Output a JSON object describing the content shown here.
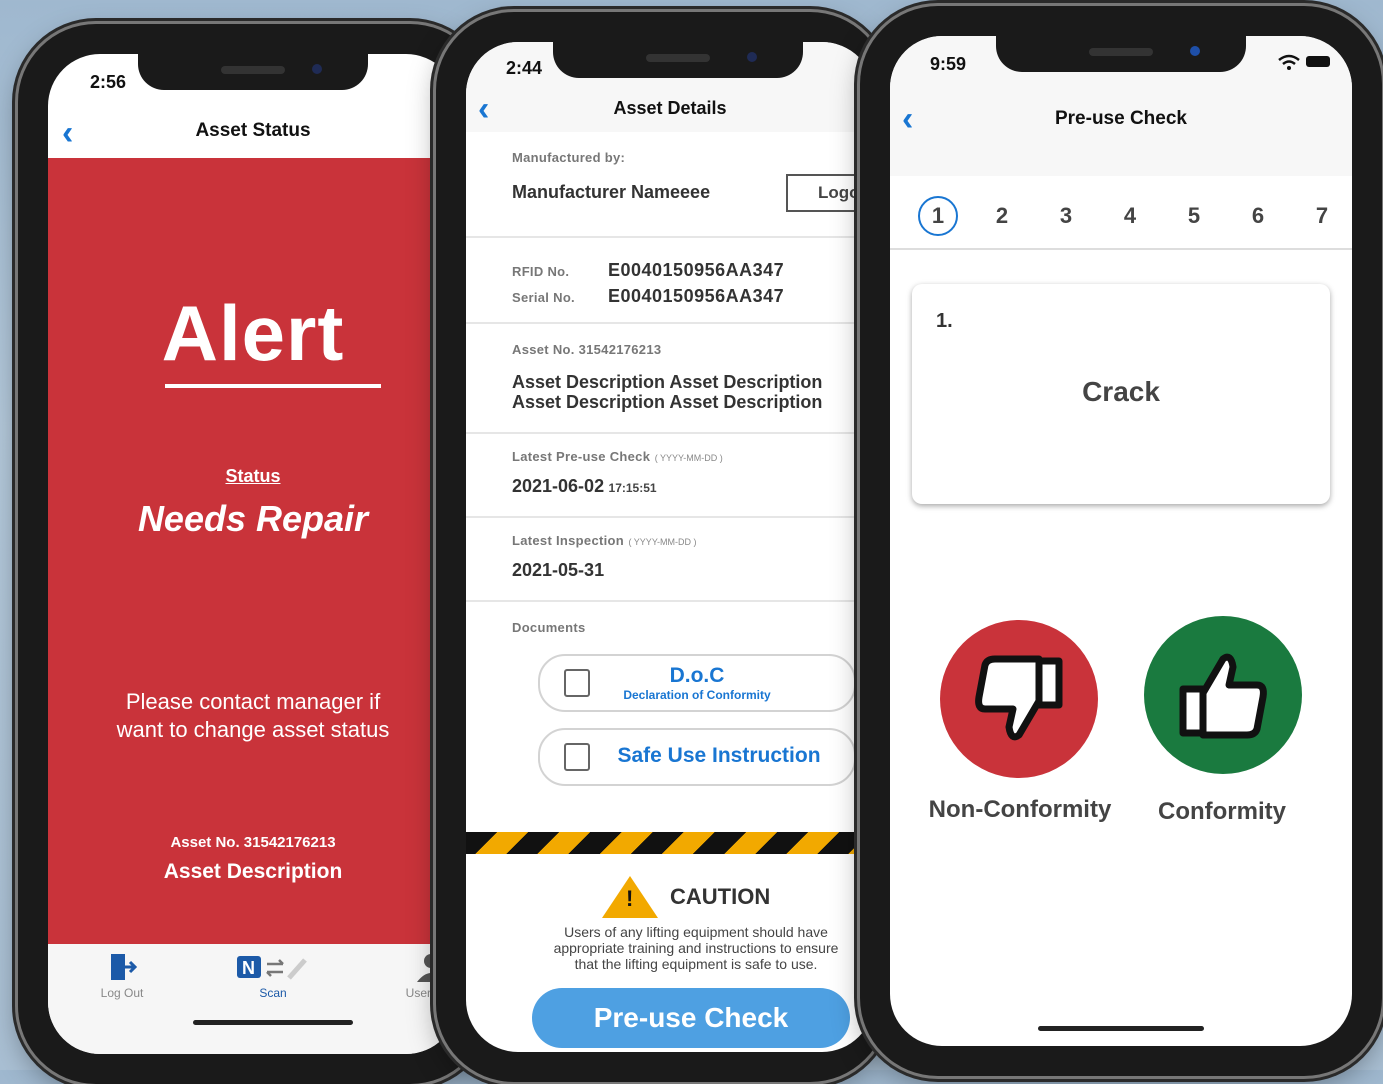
{
  "phone1": {
    "time": "2:56",
    "nav_title": "Asset Status",
    "back": "‹",
    "alert": "Alert",
    "status_label": "Status",
    "status_value": "Needs Repair",
    "contact_line1": "Please contact manager if",
    "contact_line2": "want to change asset status",
    "asset_no": "Asset No.  31542176213",
    "asset_desc": "Asset Description",
    "tabs": [
      {
        "label": "Log Out",
        "icon": "logout-icon"
      },
      {
        "label": "Scan",
        "icon": "nfc-scan-icon"
      },
      {
        "label": "User P",
        "icon": "user-icon"
      }
    ],
    "colors": {
      "alert_bg": "#c9333a",
      "accent": "#1976d2"
    }
  },
  "phone2": {
    "time": "2:44",
    "nav_title": "Asset Details",
    "manufactured_label": "Manufactured by:",
    "manufacturer_name": "Manufacturer Nameeee",
    "logo_label": "Logo",
    "rfid_label": "RFID No.",
    "rfid_value": "E0040150956AA347",
    "serial_label": "Serial No.",
    "serial_value": "E0040150956AA347",
    "asset_no": "Asset No.  31542176213",
    "asset_desc_1": "Asset Description Asset Description",
    "asset_desc_2": "Asset Description Asset Description",
    "preuse_label": "Latest Pre-use Check",
    "preuse_format": "( YYYY-MM-DD )",
    "preuse_date": "2021-06-02",
    "preuse_time": "17:15:51",
    "inspection_label": "Latest Inspection",
    "inspection_format": "( YYYY-MM-DD )",
    "inspection_date": "2021-05-31",
    "documents_label": "Documents",
    "doc1_title": "D.o.C",
    "doc1_sub": "Declaration of Conformity",
    "doc2_title": "Safe Use Instruction",
    "caution_title": "CAUTION",
    "caution_line1": "Users of any lifting equipment should have",
    "caution_line2": "appropriate training and instructions to ensure",
    "caution_line3": "that the lifting equipment is safe to use.",
    "preuse_button": "Pre-use Check",
    "colors": {
      "blue": "#1976d2",
      "button": "#4ea0e2",
      "caution": "#f2a900"
    }
  },
  "phone3": {
    "time": "9:59",
    "nav_title": "Pre-use Check",
    "steps": [
      "1",
      "2",
      "3",
      "4",
      "5",
      "6",
      "7"
    ],
    "active_step": "1",
    "card_number": "1.",
    "card_title": "Crack",
    "non_conformity": "Non-Conformity",
    "conformity": "Conformity",
    "colors": {
      "red": "#c9333a",
      "green": "#1a7a3f"
    }
  }
}
